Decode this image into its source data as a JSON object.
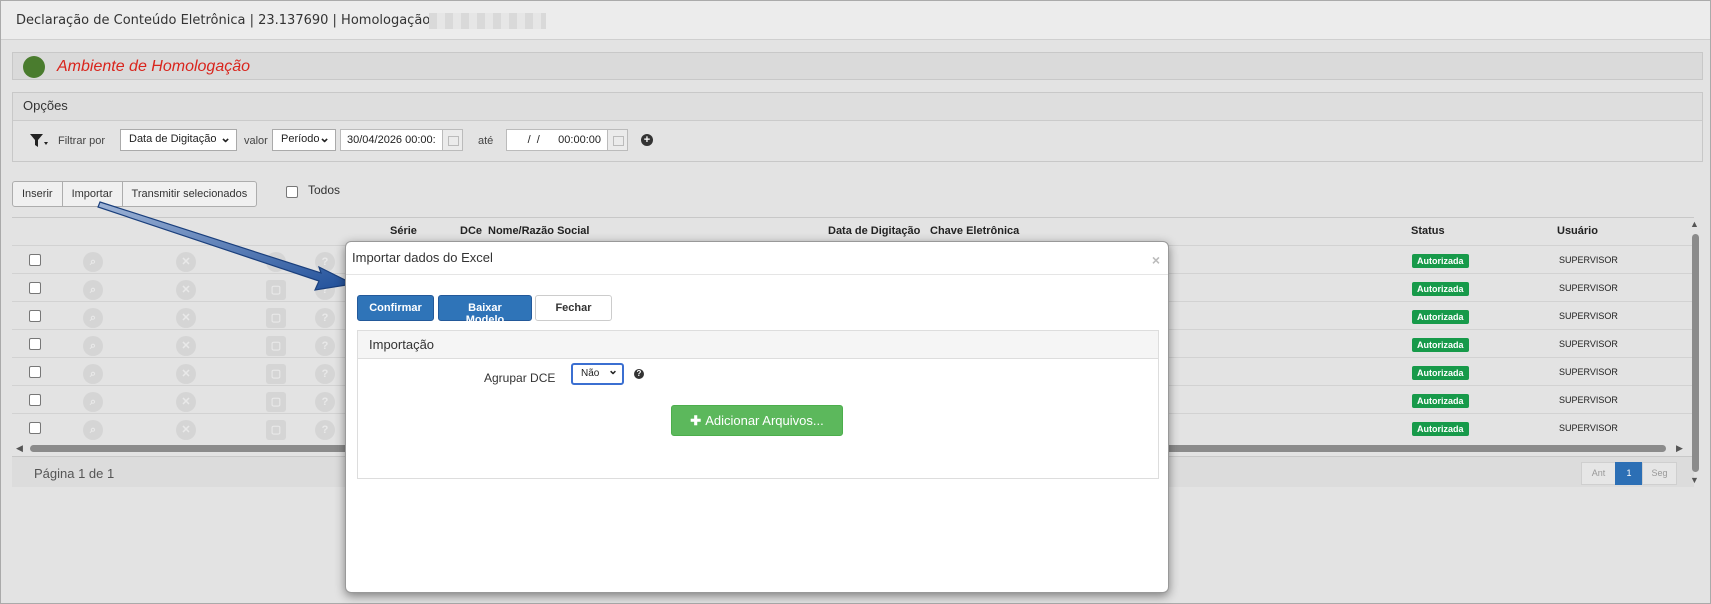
{
  "window": {
    "title": "Declaração de Conteúdo Eletrônica | 23.137690 | Homologação |"
  },
  "environment": {
    "label": "Ambiente de Homologação",
    "indicator_color": "#4a7c2e"
  },
  "options": {
    "header": "Opções",
    "filter_by_label": "Filtrar por",
    "filter_by_value": "Data de Digitação",
    "value_label": "valor",
    "value_select": "Período",
    "date_from": "30/04/2026 00:00:",
    "until_label": "até",
    "date_to": "  /  /      00:00:00"
  },
  "toolbar": {
    "insert": "Inserir",
    "import": "Importar",
    "transmit": "Transmitir selecionados",
    "all_label": "Todos"
  },
  "grid": {
    "columns": [
      "Série",
      "DCe",
      "Nome/Razão Social",
      "Data de Digitação",
      "Chave Eletrônica",
      "Status",
      "Usuário"
    ],
    "rows": [
      {
        "status": "Autorizada",
        "user": "SUPERVISOR"
      },
      {
        "status": "Autorizada",
        "user": "SUPERVISOR"
      },
      {
        "status": "Autorizada",
        "user": "SUPERVISOR"
      },
      {
        "status": "Autorizada",
        "user": "SUPERVISOR"
      },
      {
        "status": "Autorizada",
        "user": "SUPERVISOR"
      },
      {
        "status": "Autorizada",
        "user": "SUPERVISOR"
      },
      {
        "status": "Autorizada",
        "user": "SUPERVISOR"
      }
    ],
    "status_color": "#179a4a"
  },
  "footer": {
    "page_info": "Página 1 de 1",
    "prev": "Ant",
    "current": "1",
    "next": "Seg"
  },
  "modal": {
    "title": "Importar dados do Excel",
    "close": "×",
    "confirm": "Confirmar",
    "download_template": "Baixar Modelo",
    "close_button": "Fechar",
    "section_title": "Importação",
    "group_label": "Agrupar DCE",
    "group_value": "Não",
    "help": "?",
    "add_files": "Adicionar Arquivos..."
  }
}
